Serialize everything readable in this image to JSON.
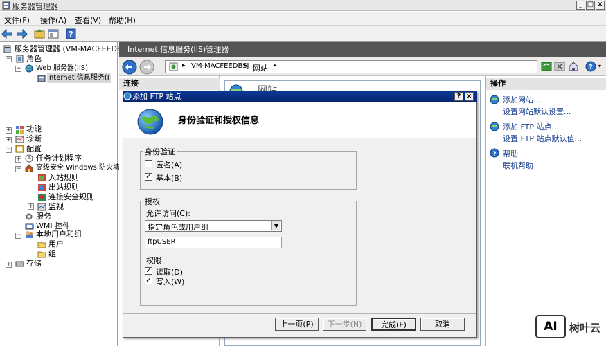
{
  "window": {
    "title": "服务器管理器"
  },
  "menu": [
    "文件(F)",
    "操作(A)",
    "查看(V)",
    "帮助(H)"
  ],
  "tree": {
    "root": "服务器管理器 (VM-MACFEEDBSJ)",
    "roles": "角色",
    "web_server": "Web 服务器(IIS)",
    "iis_manager": "Internet 信息服务(I",
    "features": "功能",
    "diagnostics": "诊断",
    "config": "配置",
    "task_scheduler": "任务计划程序",
    "firewall": "高级安全 Windows 防火墙",
    "inbound": "入站规则",
    "outbound": "出站规则",
    "connection_security": "连接安全规则",
    "monitoring": "监视",
    "services": "服务",
    "wmi": "WMI 控件",
    "local_users": "本地用户和组",
    "users": "用户",
    "groups": "组",
    "storage": "存储"
  },
  "iis": {
    "header": "Internet 信息服务(IIS)管理器",
    "breadcrumb": [
      "VM-MACFEEDBSJ",
      "网站"
    ],
    "connections_title": "连接",
    "center_title": "网站",
    "actions_title": "操作",
    "actions": [
      "添加网站...",
      "设置网站默认设置...",
      "添加 FTP 站点...",
      "设置 FTP 站点默认值...",
      "帮助",
      "联机帮助"
    ]
  },
  "dialog": {
    "title": "添加 FTP 站点",
    "heading": "身份验证和授权信息",
    "auth_group": "身份验证",
    "anonymous": {
      "label": "匿名(A)",
      "checked": false
    },
    "basic": {
      "label": "基本(B)",
      "checked": true
    },
    "authz_group": "授权",
    "allow_access_label": "允许访问(C):",
    "allow_access_value": "指定角色或用户组",
    "user_value": "ftpUSER",
    "permissions_label": "权限",
    "read": {
      "label": "读取(D)",
      "checked": true
    },
    "write": {
      "label": "写入(W)",
      "checked": true
    },
    "buttons": {
      "prev": "上一页(P)",
      "next": "下一步(N)",
      "finish": "完成(F)",
      "cancel": "取消"
    }
  },
  "watermark": {
    "logo": "AI",
    "text": "树叶云"
  }
}
